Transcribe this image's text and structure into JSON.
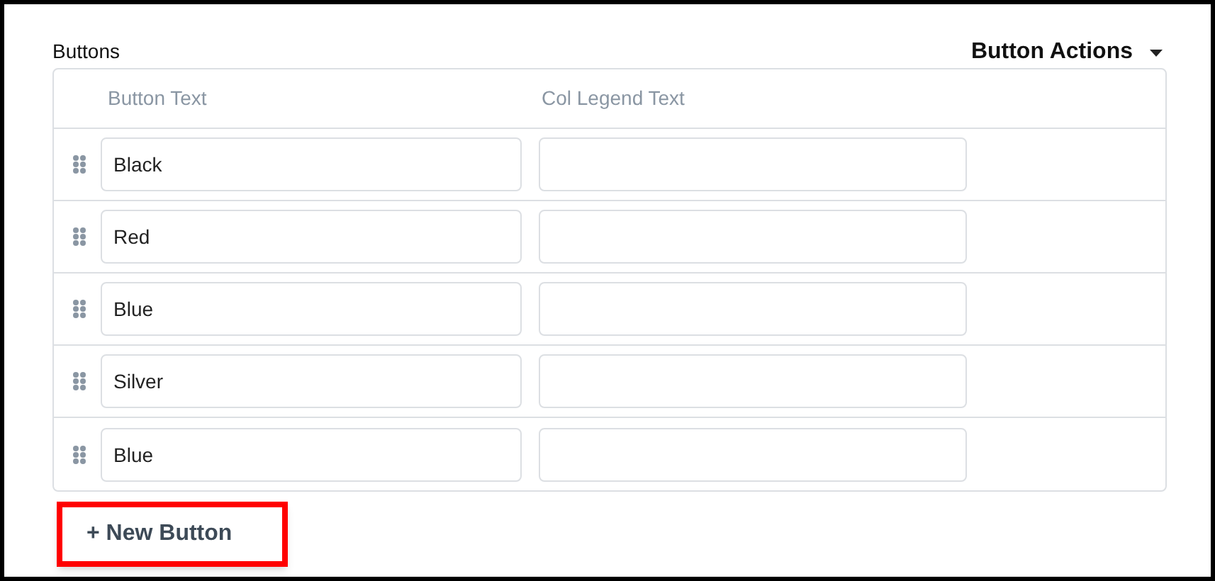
{
  "section_title": "Buttons",
  "actions_menu": {
    "label": "Button Actions"
  },
  "table": {
    "columns": [
      "Button Text",
      "Col Legend Text"
    ],
    "rows": [
      {
        "button_text": "Black"
      },
      {
        "button_text": "Red"
      },
      {
        "button_text": "Blue"
      },
      {
        "button_text": "Silver"
      },
      {
        "button_text": "Blue"
      }
    ]
  },
  "new_button": {
    "label": "+ New Button",
    "highlighted": true
  }
}
